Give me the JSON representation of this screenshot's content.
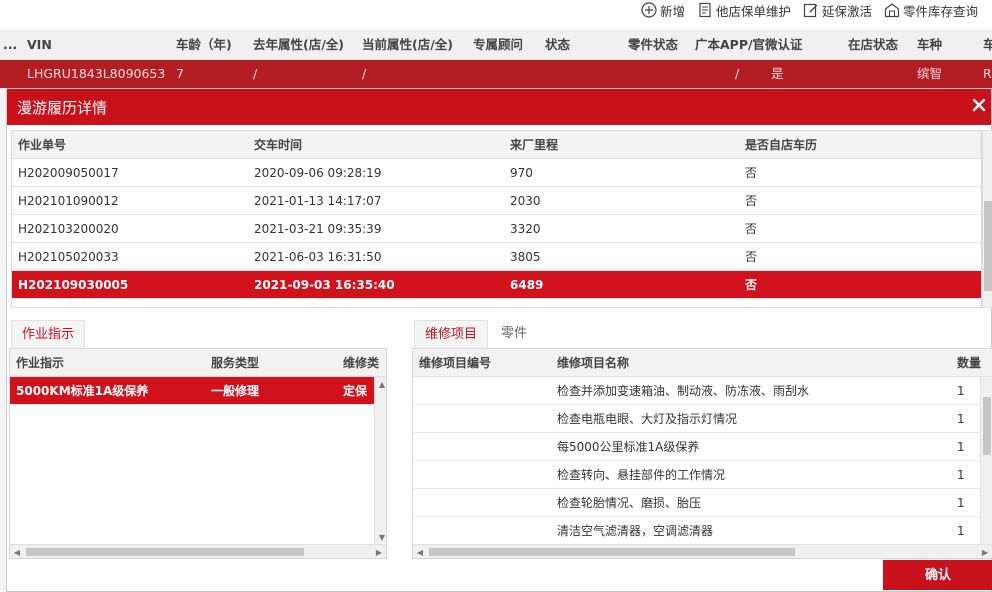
{
  "toolbar": {
    "items": [
      {
        "label": "新增",
        "icon": "plus-circle-icon"
      },
      {
        "label": "他店保单维护",
        "icon": "document-icon"
      },
      {
        "label": "延保激活",
        "icon": "edit-icon"
      },
      {
        "label": "零件库存查询",
        "icon": "warehouse-icon"
      }
    ]
  },
  "background_table": {
    "headers": [
      "...",
      "VIN",
      "车龄（年)",
      "去年属性(店/全)",
      "当前属性(店/全)",
      "专属顾问",
      "状态",
      "零件状态",
      "广本APP/官微认证",
      "在店状态",
      "车种",
      "车"
    ],
    "row": [
      "LHGRU1843L8090653",
      "7",
      "/",
      "/",
      "/",
      "是",
      "缤智",
      "R"
    ]
  },
  "modal": {
    "title": "漫游履历详情",
    "confirm_label": "确认",
    "history": {
      "headers": [
        "作业单号",
        "交车时间",
        "来厂里程",
        "是否自店车历"
      ],
      "rows": [
        [
          "H202009050017",
          "2020-09-06 09:28:19",
          "970",
          "否"
        ],
        [
          "H202101090012",
          "2021-01-13 14:17:07",
          "2030",
          "否"
        ],
        [
          "H202103200020",
          "2021-03-21 09:35:39",
          "3320",
          "否"
        ],
        [
          "H202105020033",
          "2021-06-03 16:31:50",
          "3805",
          "否"
        ],
        [
          "H202109030005",
          "2021-09-03 16:35:40",
          "6489",
          "否"
        ]
      ],
      "selected_index": 4
    },
    "left_tabs": [
      "作业指示"
    ],
    "work": {
      "headers": [
        "作业指示",
        "服务类型",
        "维修类"
      ],
      "rows": [
        [
          "5000KM标准1A级保养",
          "一般修理",
          "定保"
        ]
      ]
    },
    "right_tabs": [
      "维修项目",
      "零件"
    ],
    "repair": {
      "headers": [
        "维修项目编号",
        "维修项目名称",
        "数量"
      ],
      "rows": [
        [
          "",
          "检查并添加变速箱油、制动液、防冻液、雨刮水",
          "1"
        ],
        [
          "",
          "检查电瓶电眼、大灯及指示灯情况",
          "1"
        ],
        [
          "",
          "每5000公里标准1A级保养",
          "1"
        ],
        [
          "",
          "检查转向、悬挂部件的工作情况",
          "1"
        ],
        [
          "",
          "检查轮胎情况、磨损、胎压",
          "1"
        ],
        [
          "",
          "清洁空气滤清器，空调滤清器",
          "1"
        ]
      ]
    }
  },
  "colors": {
    "accent": "#c9111c",
    "selected_row": "#d1111c",
    "bg_row": "#b31e24"
  }
}
